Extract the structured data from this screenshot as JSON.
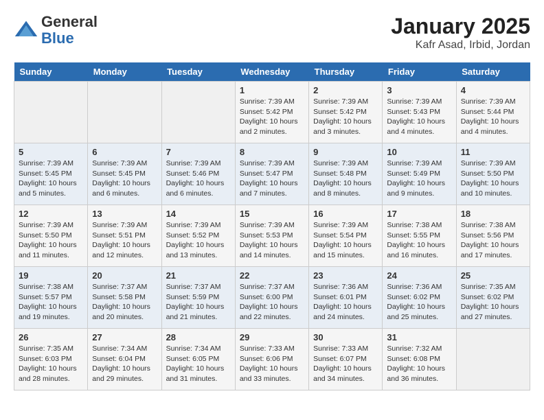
{
  "header": {
    "logo_line1": "General",
    "logo_line2": "Blue",
    "title": "January 2025",
    "subtitle": "Kafr Asad, Irbid, Jordan"
  },
  "weekdays": [
    "Sunday",
    "Monday",
    "Tuesday",
    "Wednesday",
    "Thursday",
    "Friday",
    "Saturday"
  ],
  "weeks": [
    [
      {
        "day": "",
        "info": ""
      },
      {
        "day": "",
        "info": ""
      },
      {
        "day": "",
        "info": ""
      },
      {
        "day": "1",
        "info": "Sunrise: 7:39 AM\nSunset: 5:42 PM\nDaylight: 10 hours\nand 2 minutes."
      },
      {
        "day": "2",
        "info": "Sunrise: 7:39 AM\nSunset: 5:42 PM\nDaylight: 10 hours\nand 3 minutes."
      },
      {
        "day": "3",
        "info": "Sunrise: 7:39 AM\nSunset: 5:43 PM\nDaylight: 10 hours\nand 4 minutes."
      },
      {
        "day": "4",
        "info": "Sunrise: 7:39 AM\nSunset: 5:44 PM\nDaylight: 10 hours\nand 4 minutes."
      }
    ],
    [
      {
        "day": "5",
        "info": "Sunrise: 7:39 AM\nSunset: 5:45 PM\nDaylight: 10 hours\nand 5 minutes."
      },
      {
        "day": "6",
        "info": "Sunrise: 7:39 AM\nSunset: 5:45 PM\nDaylight: 10 hours\nand 6 minutes."
      },
      {
        "day": "7",
        "info": "Sunrise: 7:39 AM\nSunset: 5:46 PM\nDaylight: 10 hours\nand 6 minutes."
      },
      {
        "day": "8",
        "info": "Sunrise: 7:39 AM\nSunset: 5:47 PM\nDaylight: 10 hours\nand 7 minutes."
      },
      {
        "day": "9",
        "info": "Sunrise: 7:39 AM\nSunset: 5:48 PM\nDaylight: 10 hours\nand 8 minutes."
      },
      {
        "day": "10",
        "info": "Sunrise: 7:39 AM\nSunset: 5:49 PM\nDaylight: 10 hours\nand 9 minutes."
      },
      {
        "day": "11",
        "info": "Sunrise: 7:39 AM\nSunset: 5:50 PM\nDaylight: 10 hours\nand 10 minutes."
      }
    ],
    [
      {
        "day": "12",
        "info": "Sunrise: 7:39 AM\nSunset: 5:50 PM\nDaylight: 10 hours\nand 11 minutes."
      },
      {
        "day": "13",
        "info": "Sunrise: 7:39 AM\nSunset: 5:51 PM\nDaylight: 10 hours\nand 12 minutes."
      },
      {
        "day": "14",
        "info": "Sunrise: 7:39 AM\nSunset: 5:52 PM\nDaylight: 10 hours\nand 13 minutes."
      },
      {
        "day": "15",
        "info": "Sunrise: 7:39 AM\nSunset: 5:53 PM\nDaylight: 10 hours\nand 14 minutes."
      },
      {
        "day": "16",
        "info": "Sunrise: 7:39 AM\nSunset: 5:54 PM\nDaylight: 10 hours\nand 15 minutes."
      },
      {
        "day": "17",
        "info": "Sunrise: 7:38 AM\nSunset: 5:55 PM\nDaylight: 10 hours\nand 16 minutes."
      },
      {
        "day": "18",
        "info": "Sunrise: 7:38 AM\nSunset: 5:56 PM\nDaylight: 10 hours\nand 17 minutes."
      }
    ],
    [
      {
        "day": "19",
        "info": "Sunrise: 7:38 AM\nSunset: 5:57 PM\nDaylight: 10 hours\nand 19 minutes."
      },
      {
        "day": "20",
        "info": "Sunrise: 7:37 AM\nSunset: 5:58 PM\nDaylight: 10 hours\nand 20 minutes."
      },
      {
        "day": "21",
        "info": "Sunrise: 7:37 AM\nSunset: 5:59 PM\nDaylight: 10 hours\nand 21 minutes."
      },
      {
        "day": "22",
        "info": "Sunrise: 7:37 AM\nSunset: 6:00 PM\nDaylight: 10 hours\nand 22 minutes."
      },
      {
        "day": "23",
        "info": "Sunrise: 7:36 AM\nSunset: 6:01 PM\nDaylight: 10 hours\nand 24 minutes."
      },
      {
        "day": "24",
        "info": "Sunrise: 7:36 AM\nSunset: 6:02 PM\nDaylight: 10 hours\nand 25 minutes."
      },
      {
        "day": "25",
        "info": "Sunrise: 7:35 AM\nSunset: 6:02 PM\nDaylight: 10 hours\nand 27 minutes."
      }
    ],
    [
      {
        "day": "26",
        "info": "Sunrise: 7:35 AM\nSunset: 6:03 PM\nDaylight: 10 hours\nand 28 minutes."
      },
      {
        "day": "27",
        "info": "Sunrise: 7:34 AM\nSunset: 6:04 PM\nDaylight: 10 hours\nand 29 minutes."
      },
      {
        "day": "28",
        "info": "Sunrise: 7:34 AM\nSunset: 6:05 PM\nDaylight: 10 hours\nand 31 minutes."
      },
      {
        "day": "29",
        "info": "Sunrise: 7:33 AM\nSunset: 6:06 PM\nDaylight: 10 hours\nand 33 minutes."
      },
      {
        "day": "30",
        "info": "Sunrise: 7:33 AM\nSunset: 6:07 PM\nDaylight: 10 hours\nand 34 minutes."
      },
      {
        "day": "31",
        "info": "Sunrise: 7:32 AM\nSunset: 6:08 PM\nDaylight: 10 hours\nand 36 minutes."
      },
      {
        "day": "",
        "info": ""
      }
    ]
  ]
}
